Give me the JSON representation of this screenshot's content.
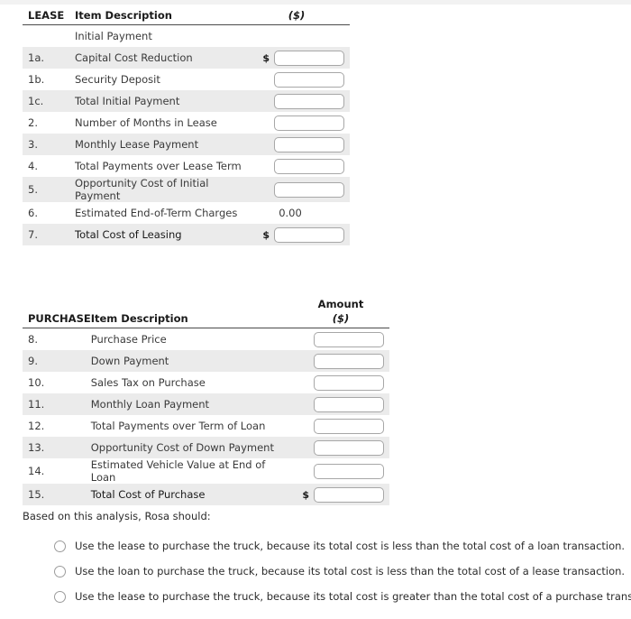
{
  "lease_table": {
    "headers": {
      "code": "LEASE",
      "description": "Item Description",
      "amount_unit": "($)"
    },
    "rows": [
      {
        "num": "",
        "desc": "Initial Payment",
        "indent": 0,
        "bold": false,
        "shaded": false,
        "input": false,
        "dollar": false,
        "value": ""
      },
      {
        "num": "1a.",
        "desc": "Capital Cost Reduction",
        "indent": 1,
        "bold": false,
        "shaded": true,
        "input": true,
        "dollar": true,
        "value": ""
      },
      {
        "num": "1b.",
        "desc": "Security Deposit",
        "indent": 1,
        "bold": false,
        "shaded": false,
        "input": true,
        "dollar": false,
        "value": ""
      },
      {
        "num": "1c.",
        "desc": "Total Initial Payment",
        "indent": 0,
        "bold": false,
        "shaded": true,
        "input": true,
        "dollar": false,
        "value": ""
      },
      {
        "num": "2.",
        "desc": "Number of Months in Lease",
        "indent": 0,
        "bold": false,
        "shaded": false,
        "input": true,
        "dollar": false,
        "value": ""
      },
      {
        "num": "3.",
        "desc": "Monthly Lease Payment",
        "indent": 0,
        "bold": false,
        "shaded": true,
        "input": true,
        "dollar": false,
        "value": ""
      },
      {
        "num": "4.",
        "desc": "Total Payments over Lease Term",
        "indent": 0,
        "bold": false,
        "shaded": false,
        "input": true,
        "dollar": false,
        "value": ""
      },
      {
        "num": "5.",
        "desc": "Opportunity Cost of Initial Payment",
        "indent": 0,
        "bold": false,
        "shaded": true,
        "input": true,
        "dollar": false,
        "value": ""
      },
      {
        "num": "6.",
        "desc": "Estimated End-of-Term Charges",
        "indent": 0,
        "bold": false,
        "shaded": false,
        "input": false,
        "dollar": false,
        "value": "0.00"
      },
      {
        "num": "7.",
        "desc": "Total Cost of Leasing",
        "indent": 0,
        "bold": true,
        "shaded": true,
        "input": true,
        "dollar": true,
        "value": ""
      }
    ]
  },
  "purchase_table": {
    "headers": {
      "amount_title": "Amount",
      "code": "PURCHASE",
      "description": "Item Description",
      "amount_unit": "($)"
    },
    "rows": [
      {
        "num": "8.",
        "desc": "Purchase Price",
        "bold": false,
        "shaded": false,
        "input": true,
        "dollar": false,
        "value": ""
      },
      {
        "num": "9.",
        "desc": "Down Payment",
        "bold": false,
        "shaded": true,
        "input": true,
        "dollar": false,
        "value": ""
      },
      {
        "num": "10.",
        "desc": "Sales Tax on Purchase",
        "bold": false,
        "shaded": false,
        "input": true,
        "dollar": false,
        "value": ""
      },
      {
        "num": "11.",
        "desc": "Monthly Loan Payment",
        "bold": false,
        "shaded": true,
        "input": true,
        "dollar": false,
        "value": ""
      },
      {
        "num": "12.",
        "desc": "Total Payments over Term of Loan",
        "bold": false,
        "shaded": false,
        "input": true,
        "dollar": false,
        "value": ""
      },
      {
        "num": "13.",
        "desc": "Opportunity Cost of Down Payment",
        "bold": false,
        "shaded": true,
        "input": true,
        "dollar": false,
        "value": ""
      },
      {
        "num": "14.",
        "desc": "Estimated Vehicle Value at End of Loan",
        "bold": false,
        "shaded": false,
        "input": true,
        "dollar": false,
        "value": ""
      },
      {
        "num": "15.",
        "desc": "Total Cost of Purchase",
        "bold": true,
        "shaded": true,
        "input": true,
        "dollar": true,
        "value": ""
      }
    ]
  },
  "question": {
    "prompt": "Based on this analysis, Rosa should:",
    "options": [
      "Use the lease to purchase the truck, because its total cost is less than the total cost of a loan transaction.",
      "Use the loan to purchase the truck, because its total cost is less than the total cost of a lease transaction.",
      "Use the lease to purchase the truck, because its total cost is greater than the total cost of a purchase transaction."
    ]
  }
}
